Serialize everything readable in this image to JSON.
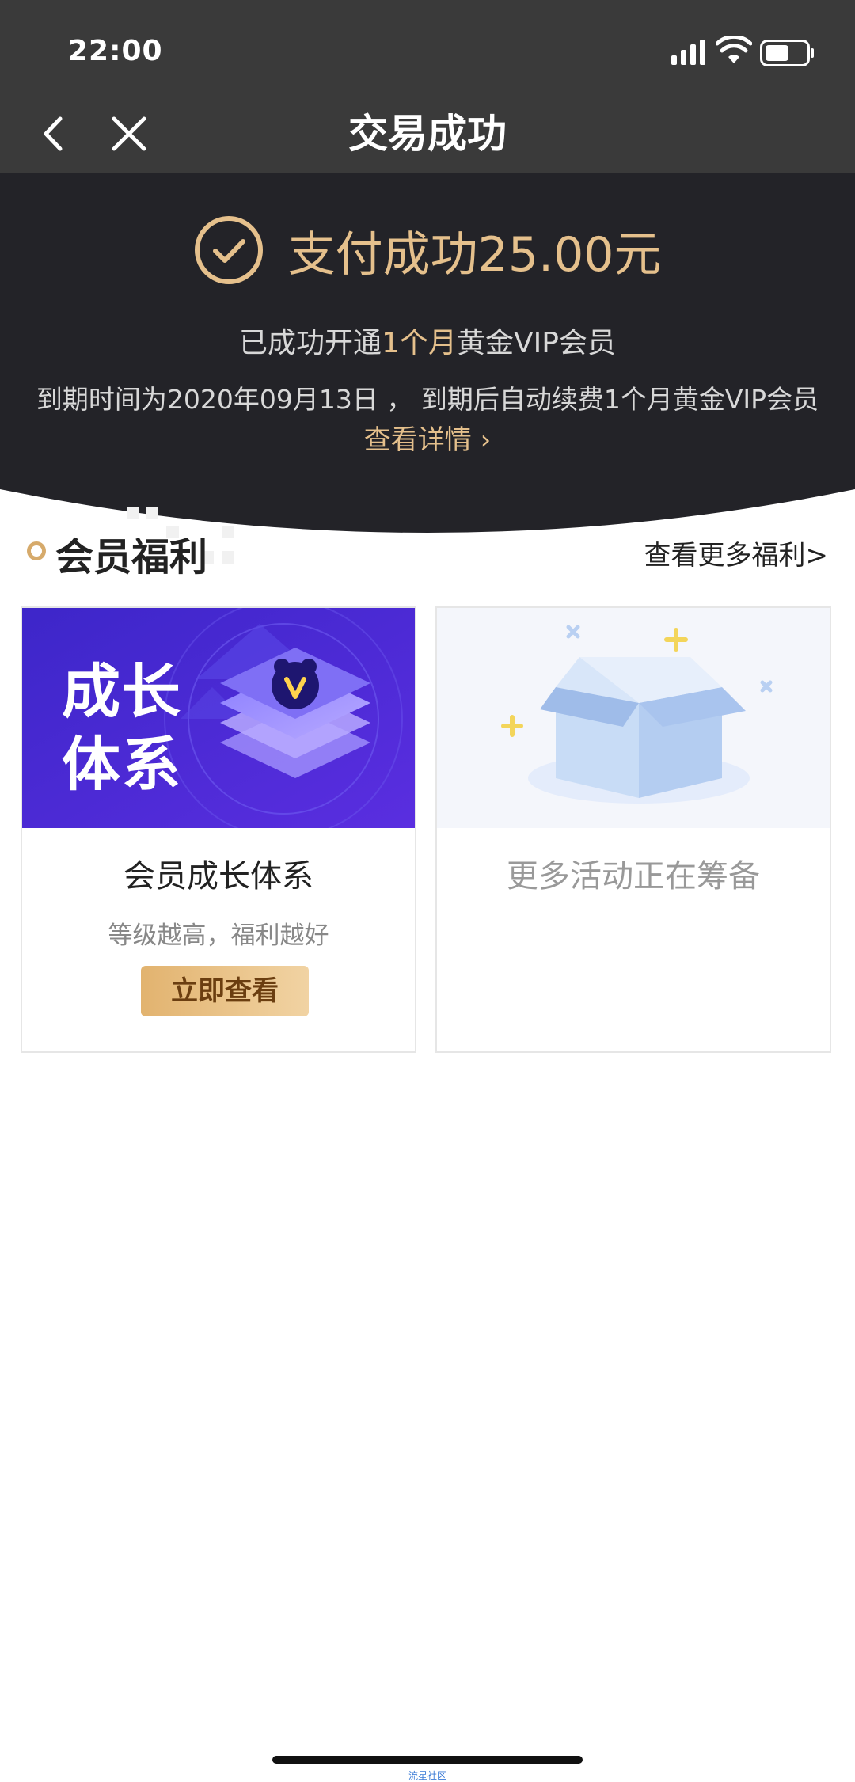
{
  "status_bar": {
    "time": "22:00"
  },
  "nav": {
    "title": "交易成功"
  },
  "hero": {
    "success_text": "支付成功25.00元",
    "open_prefix": "已成功开通",
    "open_highlight": "1个月",
    "open_suffix": "黄金VIP会员",
    "expire_text": "到期时间为2020年09月13日 ， 到期后自动续费1个月黄金VIP会员",
    "detail_link": "查看详情 ›"
  },
  "benefits": {
    "title": "会员福利",
    "more_link": "查看更多福利>",
    "cards": [
      {
        "banner_line1": "成长",
        "banner_line2": "体系",
        "title": "会员成长体系",
        "subtitle": "等级越高，福利越好",
        "button": "立即查看"
      },
      {
        "title": "更多活动正在筹备"
      }
    ]
  },
  "footer": {
    "watermark": "流星社区"
  },
  "colors": {
    "gold": "#e5c08c",
    "dark_bg": "#232328",
    "bar_bg": "#3a3a3a",
    "banner_purple": "#4a2fd6"
  }
}
